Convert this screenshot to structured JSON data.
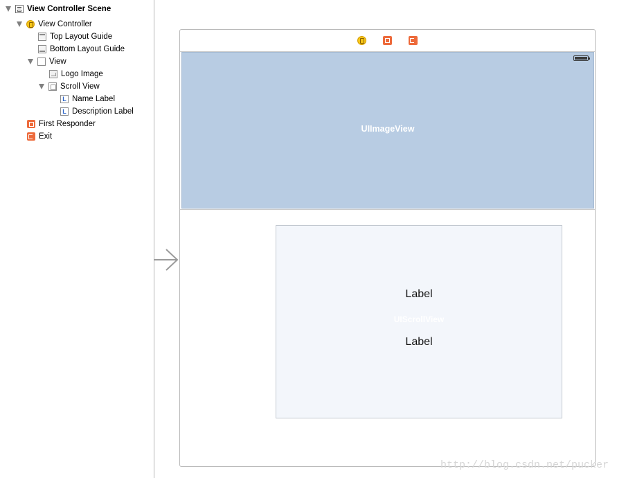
{
  "outline": {
    "items": [
      {
        "label": "View Controller Scene",
        "icon": "scene-icon"
      },
      {
        "label": "View Controller",
        "icon": "view-controller-icon"
      },
      {
        "label": "Top Layout Guide",
        "icon": "layout-guide-icon"
      },
      {
        "label": "Bottom Layout Guide",
        "icon": "layout-guide-icon"
      },
      {
        "label": "View",
        "icon": "view-icon"
      },
      {
        "label": "Logo Image",
        "icon": "image-view-icon"
      },
      {
        "label": "Scroll View",
        "icon": "scroll-view-icon"
      },
      {
        "label": "Name Label",
        "icon": "label-icon"
      },
      {
        "label": "Description Label",
        "icon": "label-icon"
      },
      {
        "label": "First Responder",
        "icon": "first-responder-icon"
      },
      {
        "label": "Exit",
        "icon": "exit-icon"
      }
    ],
    "label_glyph": "L"
  },
  "canvas": {
    "image_view_label": "UIImageView",
    "scroll_view_label": "UIScrollView",
    "name_label": "Label",
    "description_label": "Label",
    "watermark": "http://blog.csdn.net/pucker"
  },
  "colors": {
    "image_view_bg": "#b8cce3",
    "scroll_view_bg": "#f3f6fb",
    "vc_icon": "#f5c518",
    "responder_icon": "#ed6b3c"
  }
}
